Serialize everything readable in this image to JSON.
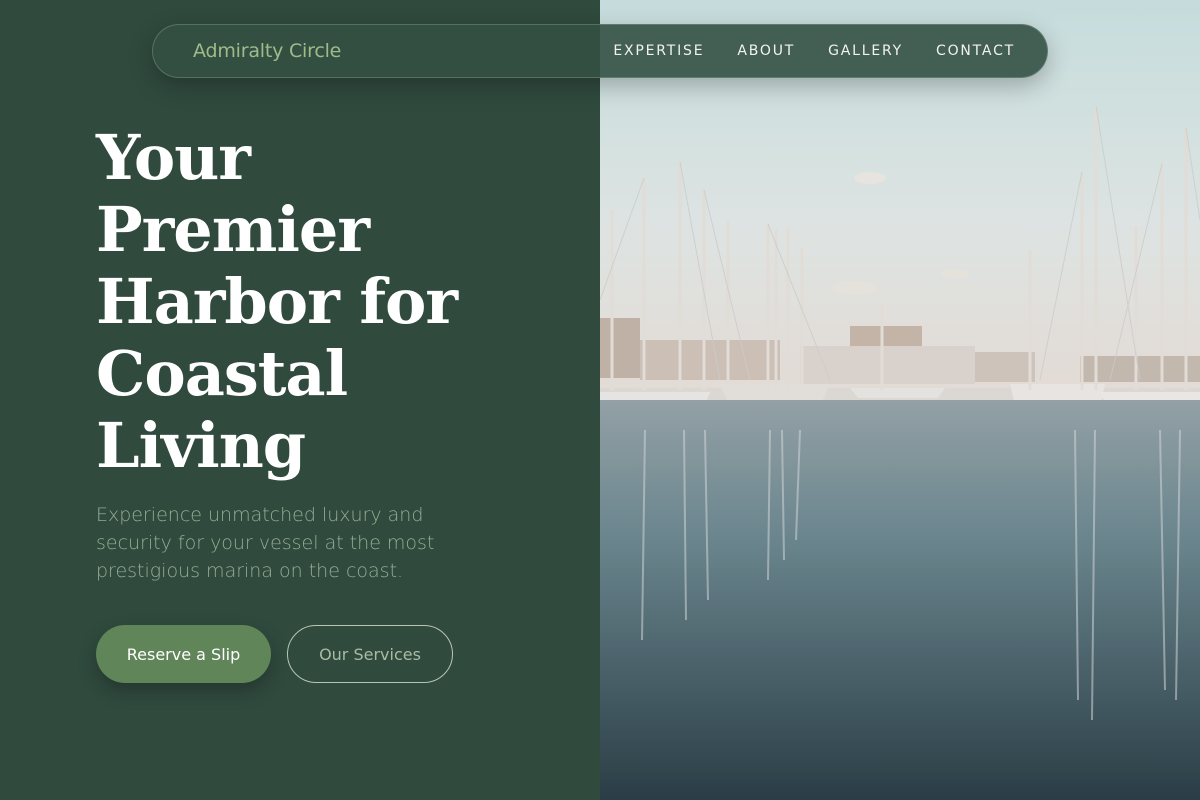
{
  "brand": {
    "name": "Admiralty Circle"
  },
  "nav": {
    "items": [
      {
        "label": "EXPERTISE"
      },
      {
        "label": "ABOUT"
      },
      {
        "label": "GALLERY"
      },
      {
        "label": "CONTACT"
      }
    ]
  },
  "hero": {
    "title_lines": [
      "Your",
      "Premier",
      "Harbor for",
      "Coastal",
      "Living"
    ],
    "subtitle_lines": [
      "Experience unmatched luxury and",
      "security for your vessel at the most",
      "prestigious marina on the coast."
    ],
    "primary_cta": "Reserve a Slip",
    "secondary_cta": "Our Services"
  },
  "image": {
    "icon": "marina-photo"
  },
  "colors": {
    "panel_bg": "#304a3e",
    "brand_text": "#9fbb8a",
    "primary_button": "#5f8558",
    "subtitle_text": "#97ab92"
  }
}
